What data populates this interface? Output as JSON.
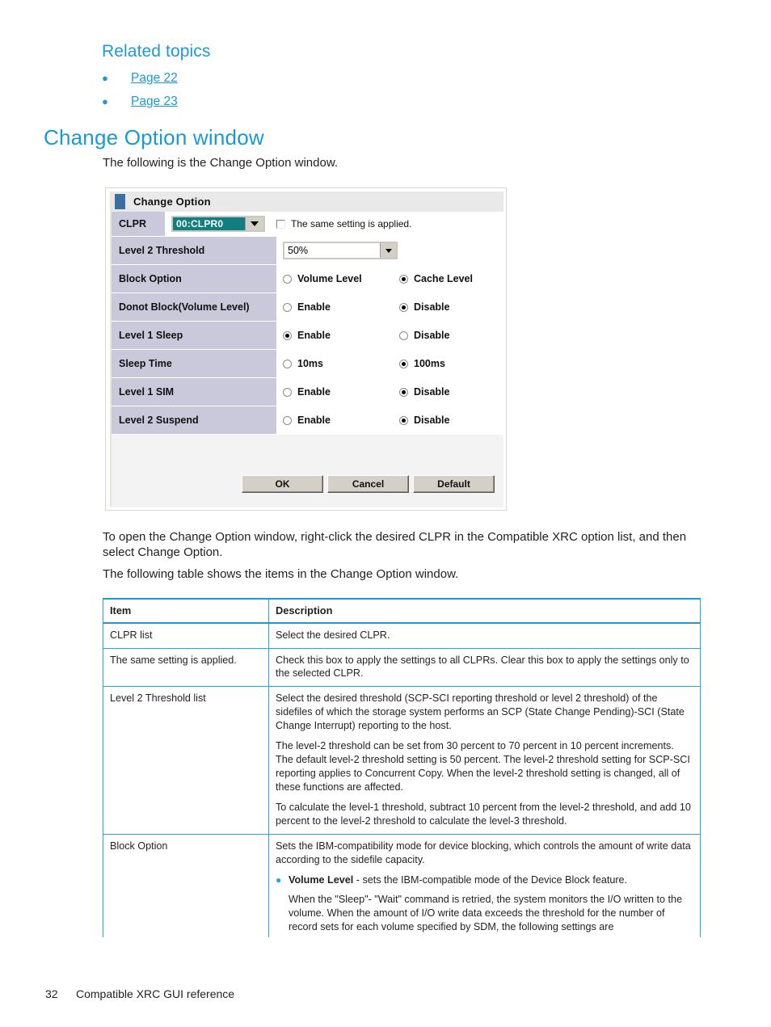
{
  "related": {
    "heading": "Related topics",
    "links": [
      "Page 22",
      "Page 23"
    ]
  },
  "section": {
    "heading": "Change Option window",
    "intro": "The following is the Change Option window."
  },
  "dialog": {
    "title": "Change Option",
    "clpr": {
      "label": "CLPR",
      "value": "00:CLPR0",
      "checkbox_label": "The same setting is applied.",
      "checkbox_checked": false
    },
    "threshold": {
      "label": "Level 2 Threshold",
      "value": "50%"
    },
    "rows": [
      {
        "label": "Block Option",
        "option1": "Volume Level",
        "option1_selected": false,
        "option2": "Cache Level",
        "option2_selected": true
      },
      {
        "label": "Donot Block(Volume Level)",
        "option1": "Enable",
        "option1_selected": false,
        "option2": "Disable",
        "option2_selected": true
      },
      {
        "label": "Level 1 Sleep",
        "option1": "Enable",
        "option1_selected": true,
        "option2": "Disable",
        "option2_selected": false
      },
      {
        "label": "Sleep Time",
        "option1": "10ms",
        "option1_selected": false,
        "option2": "100ms",
        "option2_selected": true
      },
      {
        "label": "Level 1 SIM",
        "option1": "Enable",
        "option1_selected": false,
        "option2": "Disable",
        "option2_selected": true
      },
      {
        "label": "Level 2 Suspend",
        "option1": "Enable",
        "option1_selected": false,
        "option2": "Disable",
        "option2_selected": true
      }
    ],
    "buttons": {
      "ok": "OK",
      "cancel": "Cancel",
      "default": "Default"
    },
    "colors": {
      "selected_value_bg": "#117f7f",
      "label_bg": "#c9c9db",
      "titlebar_bg": "#e9e9e9",
      "button_face": "#d4d0c8"
    }
  },
  "body_paragraphs": {
    "p1": "To open the Change Option window, right-click the desired CLPR in the Compatible XRC option list, and then select Change Option.",
    "p2": "The following table shows the items in the Change Option window."
  },
  "table": {
    "headers": [
      "Item",
      "Description"
    ],
    "rows": [
      {
        "item": "CLPR list",
        "desc_p1": "Select the desired CLPR."
      },
      {
        "item": "The same setting is applied.",
        "desc_p1": "Check this box to apply the settings to all CLPRs. Clear this box to apply the settings only to the selected CLPR."
      },
      {
        "item": "Level 2 Threshold list",
        "desc_p1": "Select the desired threshold (SCP-SCI reporting threshold or level 2 threshold) of the sidefiles of which the storage system performs an SCP (State Change Pending)-SCI (State Change Interrupt) reporting to the host.",
        "desc_p2": "The level-2 threshold can be set from 30 percent to 70 percent in 10 percent increments. The default level-2 threshold setting is 50 percent. The level-2 threshold setting for SCP-SCI reporting applies to Concurrent Copy. When the level-2 threshold setting is changed, all of these functions are affected.",
        "desc_p3": "To calculate the level-1 threshold, subtract 10 percent from the level-2 threshold, and add 10 percent to the level-2 threshold to calculate the level-3 threshold."
      },
      {
        "item": "Block Option",
        "desc_p1": "Sets the IBM-compatibility mode for device blocking, which controls the amount of write data according to the sidefile capacity.",
        "bullet_bold": "Volume Level",
        "bullet_rest": " - sets the IBM-compatible mode of the Device Block feature.",
        "bullet_sub": "When the \"Sleep\"- \"Wait\" command is retried, the system monitors the I/O written to the volume. When the amount of I/O write data exceeds the threshold for the number of record sets for each volume specified by SDM, the following settings are"
      }
    ]
  },
  "footer": {
    "page_number": "32",
    "title": "Compatible XRC GUI reference"
  },
  "theme": {
    "accent_blue": "#1b9ad6",
    "table_border_blue": "#2ba3dd",
    "text": "#231f20"
  }
}
